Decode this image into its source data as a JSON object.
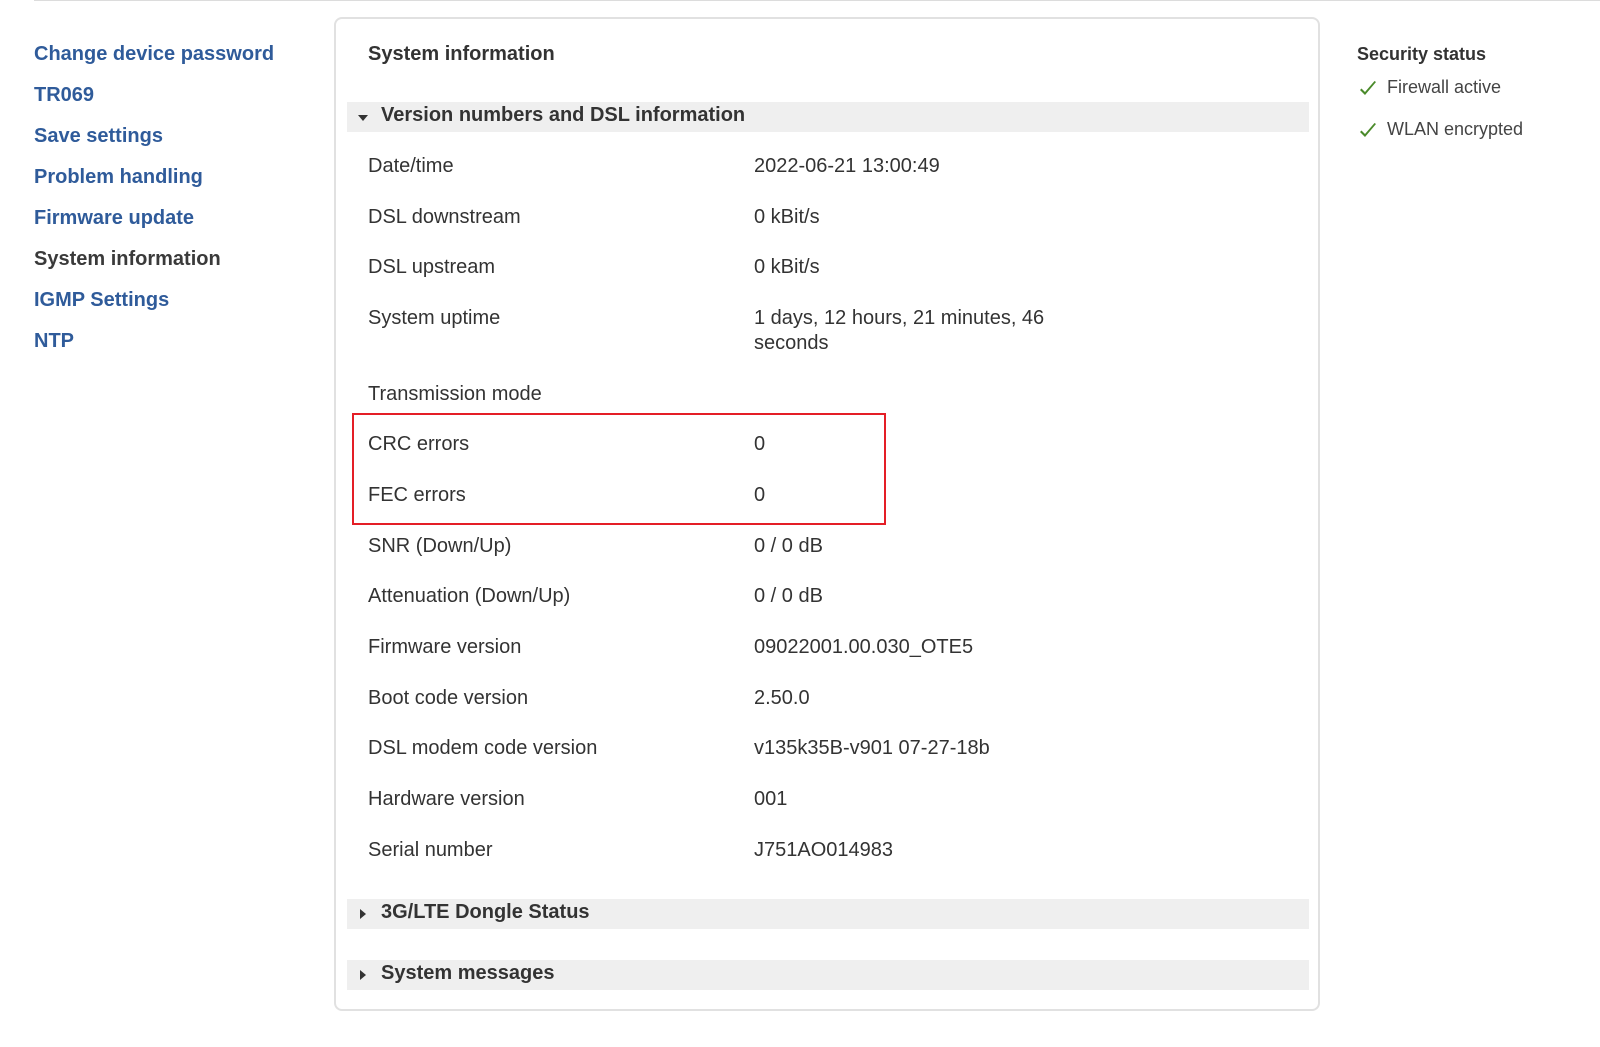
{
  "sidebar": {
    "items": [
      {
        "label": "Change device password",
        "active": false
      },
      {
        "label": "TR069",
        "active": false
      },
      {
        "label": "Save settings",
        "active": false
      },
      {
        "label": "Problem handling",
        "active": false
      },
      {
        "label": "Firmware update",
        "active": false
      },
      {
        "label": "System information",
        "active": true
      },
      {
        "label": "IGMP Settings",
        "active": false
      },
      {
        "label": "NTP",
        "active": false
      }
    ]
  },
  "panel": {
    "title": "System information",
    "sections": [
      {
        "label": "Version numbers and DSL information",
        "expanded": true
      },
      {
        "label": "3G/LTE Dongle Status",
        "expanded": false
      },
      {
        "label": "System messages",
        "expanded": false
      }
    ],
    "rows": [
      {
        "key": "Date/time",
        "value": "2022-06-21 13:00:49"
      },
      {
        "key": "DSL downstream",
        "value": "0 kBit/s"
      },
      {
        "key": "DSL upstream",
        "value": "0 kBit/s"
      },
      {
        "key": "System uptime",
        "value": "1 days, 12 hours, 21 minutes, 46 seconds"
      },
      {
        "key": "Transmission mode",
        "value": ""
      },
      {
        "key": "CRC errors",
        "value": "0"
      },
      {
        "key": "FEC errors",
        "value": "0"
      },
      {
        "key": "SNR (Down/Up)",
        "value": "0 / 0 dB"
      },
      {
        "key": "Attenuation (Down/Up)",
        "value": "0 / 0 dB"
      },
      {
        "key": "Firmware version",
        "value": "09022001.00.030_OTE5"
      },
      {
        "key": "Boot code version",
        "value": "2.50.0"
      },
      {
        "key": "DSL modem code version",
        "value": "v135k35B-v901 07-27-18b"
      },
      {
        "key": "Hardware version",
        "value": "001"
      },
      {
        "key": "Serial number",
        "value": "J751AO014983"
      }
    ]
  },
  "security": {
    "title": "Security status",
    "items": [
      {
        "label": "Firewall active",
        "icon": "check-icon"
      },
      {
        "label": "WLAN encrypted",
        "icon": "check-icon"
      }
    ]
  },
  "colors": {
    "link": "#2f5b9a",
    "text": "#333333",
    "section_bg": "#efefef",
    "highlight": "#e41e26",
    "check": "#4a8a2a"
  }
}
